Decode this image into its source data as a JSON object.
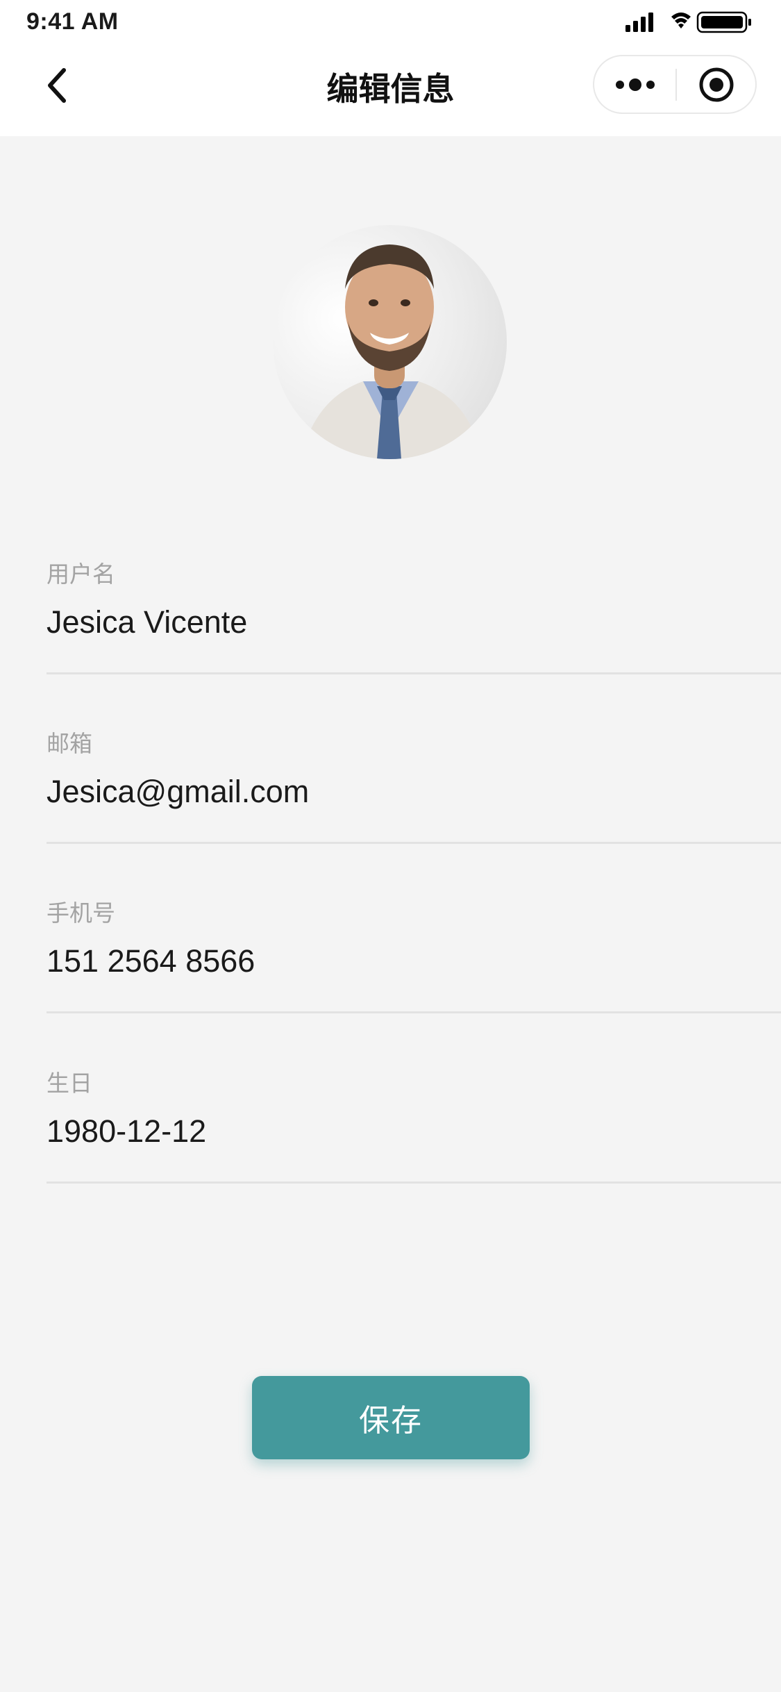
{
  "status_bar": {
    "time": "9:41 AM"
  },
  "nav": {
    "title": "编辑信息"
  },
  "colors": {
    "accent": "#44999c",
    "label": "#a3a3a3",
    "background": "#f4f4f4"
  },
  "icons": {
    "back": "chevron-left-icon",
    "more": "more-dots-icon",
    "close": "target-circle-icon",
    "signal": "cellular-signal-icon",
    "wifi": "wifi-icon",
    "battery": "battery-icon"
  },
  "profile": {
    "fields": [
      {
        "label": "用户名",
        "value": "Jesica Vicente"
      },
      {
        "label": "邮箱",
        "value": "Jesica@gmail.com"
      },
      {
        "label": "手机号",
        "value": "151 2564 8566"
      },
      {
        "label": "生日",
        "value": "1980-12-12"
      }
    ]
  },
  "actions": {
    "save_label": "保存"
  }
}
